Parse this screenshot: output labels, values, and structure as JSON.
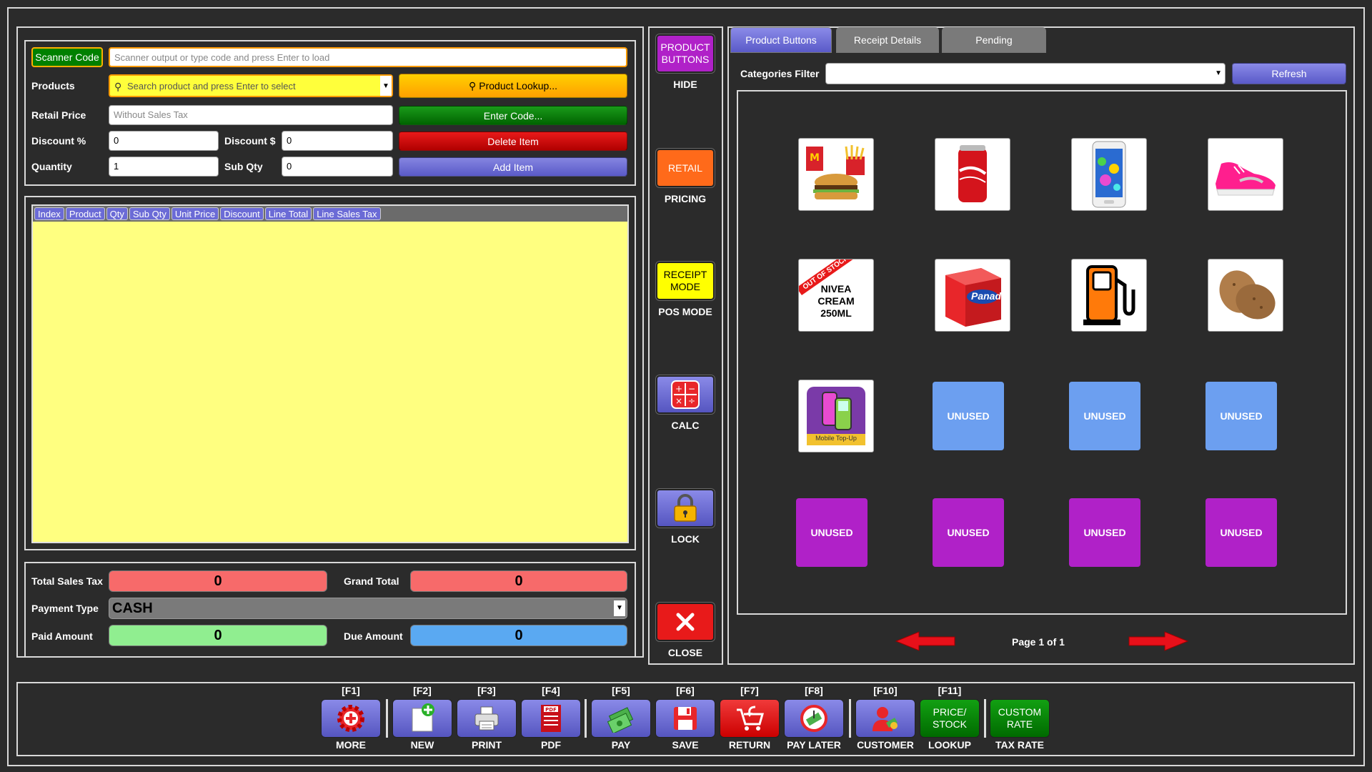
{
  "entry": {
    "scanner_label": "Scanner Code",
    "scanner_placeholder": "Scanner output or type code and press Enter to load",
    "products_label": "Products",
    "products_placeholder": "Search product and press Enter to select",
    "product_lookup_button": "Product Lookup...",
    "retail_price_label": "Retail Price",
    "retail_price_placeholder": "Without Sales Tax",
    "enter_code_button": "Enter Code...",
    "discount_pct_label": "Discount %",
    "discount_pct_value": "0",
    "discount_amt_label": "Discount $",
    "discount_amt_value": "0",
    "delete_item_button": "Delete Item",
    "quantity_label": "Quantity",
    "quantity_value": "1",
    "sub_qty_label": "Sub Qty",
    "sub_qty_value": "0",
    "add_item_button": "Add Item"
  },
  "grid": {
    "columns": [
      "Index",
      "Product",
      "Qty",
      "Sub Qty",
      "Unit Price",
      "Discount",
      "Line Total",
      "Line Sales Tax"
    ]
  },
  "totals": {
    "total_sales_tax_label": "Total Sales Tax",
    "total_sales_tax_value": "0",
    "grand_total_label": "Grand Total",
    "grand_total_value": "0",
    "payment_type_label": "Payment Type",
    "payment_type_value": "CASH",
    "paid_amount_label": "Paid Amount",
    "paid_amount_value": "0",
    "due_amount_label": "Due Amount",
    "due_amount_value": "0"
  },
  "side": {
    "product_buttons": "PRODUCT BUTTONS",
    "hide": "HIDE",
    "retail": "RETAIL",
    "pricing": "PRICING",
    "receipt_mode": "RECEIPT MODE",
    "pos_mode": "POS MODE",
    "calc": "CALC",
    "lock": "LOCK",
    "close": "CLOSE"
  },
  "tabs": {
    "product_buttons": "Product Buttons",
    "receipt_details": "Receipt Details",
    "pending": "Pending"
  },
  "filter": {
    "label": "Categories Filter",
    "value": "",
    "refresh": "Refresh"
  },
  "products": {
    "nivea_stamp": "OUT OF STOCK",
    "nivea_name": "NIVEA CREAM 250ML",
    "topup_caption": "Mobile Top-Up",
    "panadol_brand": "Panadol",
    "unused": "UNUSED"
  },
  "pager": {
    "text": "Page 1 of 1"
  },
  "fkeys": [
    {
      "key": "[F1]",
      "label": "MORE"
    },
    {
      "key": "[F2]",
      "label": "NEW"
    },
    {
      "key": "[F3]",
      "label": "PRINT"
    },
    {
      "key": "[F4]",
      "label": "PDF"
    },
    {
      "key": "[F5]",
      "label": "PAY"
    },
    {
      "key": "[F6]",
      "label": "SAVE"
    },
    {
      "key": "[F7]",
      "label": "RETURN"
    },
    {
      "key": "[F8]",
      "label": "PAY LATER"
    },
    {
      "key": "[F10]",
      "label": "CUSTOMER"
    },
    {
      "key": "[F11]",
      "label": "PRICE/ STOCK",
      "label2": "LOOKUP"
    },
    {
      "key": "",
      "label": "CUSTOM RATE",
      "label2": "TAX RATE"
    }
  ],
  "colors": {
    "grid_yellow": "#ffff80",
    "tax_red": "#f76a6a",
    "paid_green": "#90ee90",
    "due_blue": "#5aa9f2",
    "unused_blue": "#6c9ff0",
    "unused_purple": "#b021c8"
  }
}
